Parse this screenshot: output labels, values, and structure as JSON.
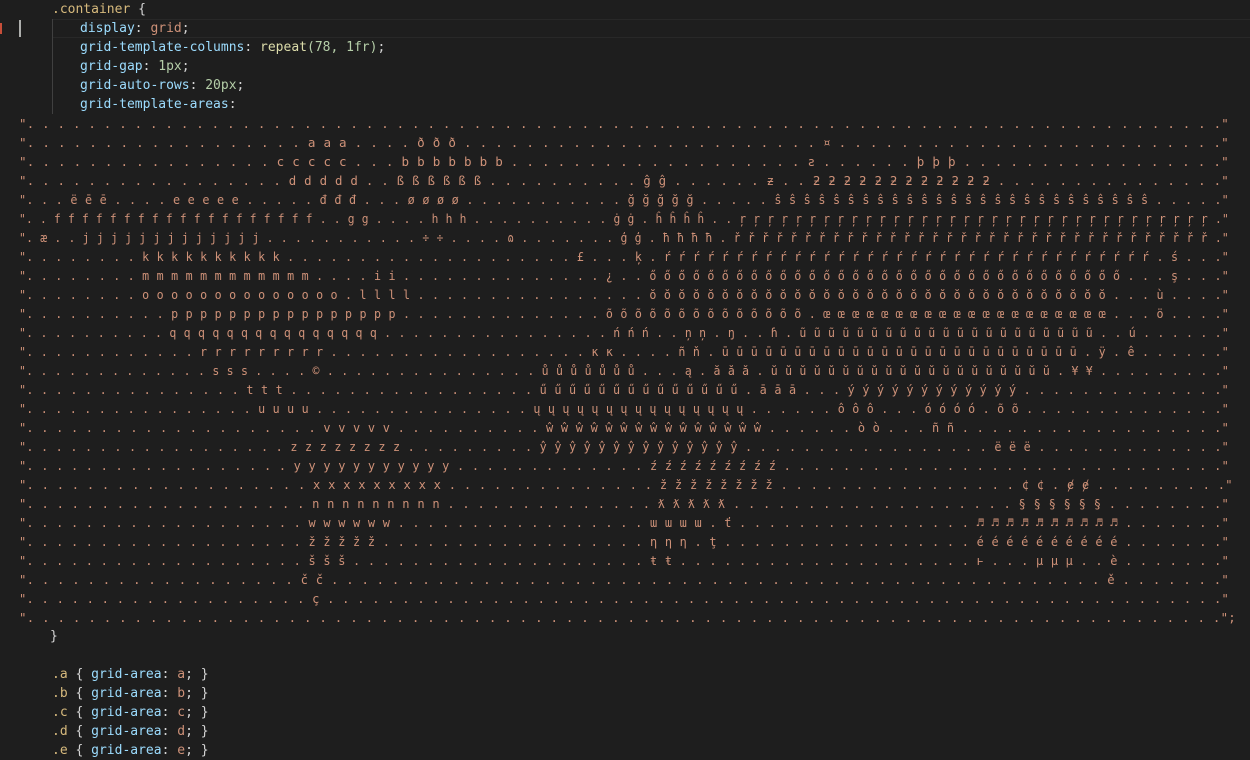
{
  "editor": {
    "code_lines": [
      {
        "kind": "selector_open",
        "selector": ".container",
        "brace": " {"
      },
      {
        "kind": "decl",
        "prop": "display",
        "value": "grid"
      },
      {
        "kind": "decl",
        "prop": "grid-template-columns",
        "fn": "repeat",
        "args": "(78, 1fr)"
      },
      {
        "kind": "decl",
        "prop": "grid-gap",
        "value": "1px"
      },
      {
        "kind": "decl",
        "prop": "grid-auto-rows",
        "value": "20px"
      },
      {
        "kind": "decl_open",
        "prop": "grid-template-areas"
      }
    ],
    "area_rows": [
      "\". . . . . . . . . . . . . . . . . . . . . . . . . . . . . . . . . . . . . . . . . . . . . . . . . . . . . . . . . . . . . . . . . . . . . . . . . . . . . .\"",
      "\". . . . . . . . . . . . . . . . . . a a a . . . . ð ð ð . . . . . . . . . . . . . . . . . . . . . . . ¤ . . . . . . . . . . . . . . . . . . . . . . . . .\"",
      "\". . . . . . . . . . . . . . . . c c c c c . . . b b b b b b b . . . . . . . . . . . . . . . . . . . ƨ . . . . . . þ þ þ . . . . . . . . . . . . . . . . .\"",
      "\". . . . . . . . . . . . . . . . . d d d d d . . ß ß ß ß ß ß . . . . . . . . . . ĝ ĝ . . . . . . ƶ . . ƻ ƻ ƻ ƻ ƻ ƻ ƻ ƻ ƻ ƻ ƻ ƻ . . . . . . . . . . . . . . .\"",
      "\". . . ë ē ē . . . . e e e e e . . . . . đ đ đ . . . ø ø ø ø . . . . . . . . . . . ğ ğ ğ ğ ğ . . . . . ŝ ŝ ŝ ŝ ŝ ŝ ŝ ŝ ŝ ŝ ŝ ŝ ŝ ŝ ŝ ŝ ŝ ŝ ŝ ŝ ŝ ŝ ŝ ŝ ŝ ŝ . . . . .\"",
      "\". . f f f f f f f f f f f f f f f f f f f . . g g . . . . h h h . . . . . . . . . . ġ ġ . ĥ ĥ ĥ ĥ . . ŗ ŗ ŗ ŗ ŗ ŗ ŗ ŗ ŗ ŗ ŗ ŗ ŗ ŗ ŗ ŗ ŗ ŗ ŗ ŗ ŗ ŗ ŗ ŗ ŗ ŗ ŗ ŗ ŗ ŗ ŗ ŗ ŗ ŗ .\"",
      "\". æ . . j j j j j j j j j j j j j . . . . . . . . . . . ÷ ÷ . . . . ɷ . . . . . . . ģ ģ . ħ ħ ħ ħ . ř ř ř ř ř ř ř ř ř ř ř ř ř ř ř ř ř ř ř ř ř ř ř ř ř ř ř ř ř ř ř ř ř ř .\"",
      "\". . . . . . . . k k k k k k k k k k . . . . . . . . . . . . . . . . . . . . £ . . . ķ . ŕ ŕ ŕ ŕ ŕ ŕ ŕ ŕ ŕ ŕ ŕ ŕ ŕ ŕ ŕ ŕ ŕ ŕ ŕ ŕ ŕ ŕ ŕ ŕ ŕ ŕ ŕ ŕ ŕ ŕ ŕ ŕ ŕ ŕ . ś . . .\"",
      "\". . . . . . . . m m m m m m m m m m m m . . . . i i . . . . . . . . . . . . . . ¿ . . ő ő ő ő ő ő ő ő ő ő ő ő ő ő ő ő ő ő ő ő ő ő ő ő ő ő ő ő ő ő ő ő ő . . . ş . . .\"",
      "\". . . . . . . . o o o o o o o o o o o o o o . l l l l . . . . . . . . . . . . . . . . ŏ ŏ ŏ ŏ ŏ ŏ ŏ ŏ ŏ ŏ ŏ ŏ ŏ ŏ ŏ ŏ ŏ ŏ ŏ ŏ ŏ ŏ ŏ ŏ ŏ ŏ ŏ ŏ ŏ ŏ ŏ ŏ . . . ù . . . .\"",
      "\". . . . . . . . . . p p p p p p p p p p p p p p p p . . . . . . . . . . . . . . õ õ õ õ õ õ õ õ õ õ õ õ õ õ . œ œ œ œ œ œ œ œ œ œ œ œ œ œ œ œ œ œ œ œ . . . ö . . . .\"",
      "\". . . . . . . . . . q q q q q q q q q q q q q q q . . . . . . . . . . . . . . . . ń ń ń . . ņ ņ . ŋ . . ɦ . ũ ũ ũ ũ ũ ũ ũ ũ ũ ũ ũ ũ ũ ũ ũ ũ ũ ũ ũ ũ ũ . . ú . . . . . .\"",
      "\". . . . . . . . . . . . r r r r r r r r r . . . . . . . . . . . . . . . . . . ĸ ĸ . . . . ñ ň . ū ū ū ū ū ū ū ū ū ū ū ū ū ū ū ū ū ū ū ū ū ū ū ū ū . ÿ . ê . . . . . .\"",
      "\". . . . . . . . . . . . . s s s . . . . © . . . . . . . . . . . . . . . ů ů ů ů ů ů ů . . . ą . ă ă ă . ŭ ŭ ŭ ŭ ŭ ŭ ŭ ŭ ŭ ŭ ŭ ŭ ŭ ŭ ŭ ŭ ŭ ŭ ŭ ŭ . ¥ ¥ . . . . . . . . .\"",
      "\". . . . . . . . . . . . . . . t t t . . . . . . . . . . . . . . . . . ű ű ű ű ű ű ű ű ű ű ű ű ű ű . ā ā ā . . . ý ý ý ý ý ý ý ý ý ý ý ý . . . . . . . . . . . . . .\"",
      "\". . . . . . . . . . . . . . . . u u u u . . . . . . . . . . . . . . . ų ų ų ų ų ų ų ų ų ų ų ų ų ų ų . . . . . . ô ô ô . . . ó ó ó ó . õ õ . . . . . . . . . . . . . .\"",
      "\". . . . . . . . . . . . . . . . . . . . v v v v v . . . . . . . . . . ŵ ŵ ŵ ŵ ŵ ŵ ŵ ŵ ŵ ŵ ŵ ŵ ŵ ŵ ŵ . . . . . . ò ò . . . ñ ñ . . . . . . . . . . . . . . . . . .\"",
      "\". . . . . . . . . . . . . . . . . . z z z z z z z z . . . . . . . . . ŷ ŷ ŷ ŷ ŷ ŷ ŷ ŷ ŷ ŷ ŷ ŷ ŷ ŷ . . . . . . . . . . . . . . . . . ë ë ë . . . . . . . . . . . . .\"",
      "\". . . . . . . . . . . . . . . . . . y y y y y y y y y y y . . . . . . . . . . . . . ź ź ź ź ź ź ź ź ź . . . . . . . . . . . . . . . . . . . . . . . . . . . . . .\"",
      "\". . . . . . . . . . . . . . . . . . . x x x x x x x x x . . . . . . . . . . . . . . ž ž ž ž ž ž ž ž . . . . . . . . . . . . . . . . ¢ ¢ . ɇ ɇ . . . . . . . . .\"",
      "\". . . . . . . . . . . . . . . . . . . n n n n n n n n n . . . . . . . . . . . . . . ƛ ƛ ƛ ƛ ƛ . . . . . . . . . . . . . . . . . . . § § § § § § . . . . . . . .\"",
      "\". . . . . . . . . . . . . . . . . . . w w w w w w . . . . . . . . . . . . . . . . . ɯ ɯ ɯ ɯ . ť . . . . . . . . . . . . . . . . ♬ ♬ ♬ ♬ ♬ ♬ ♬ ♬ ♬ ♬ . . . . . . .\"",
      "\". . . . . . . . . . . . . . . . . . . ž ž ž ž ž . . . . . . . . . . . . . . . . . . η η η . ţ . . . . . . . . . . . . . . . . . é é é é é é é é é é . . . . . . .\"",
      "\". . . . . . . . . . . . . . . . . . . š š š . . . . . . . . . . . . . . . . . . . . ŧ ŧ . . . . . . . . . . . . . . . . . . . . ⱶ . . . μ μ μ . . è . . . . . . .\"",
      "\". . . . . . . . . . . . . . . . . . č č . . . . . . . . . . . . . . . . . . . . . . . . . . . . . . . . . . . . . . . . . . . . . . . . . . . ě . . . . . . .\"",
      "\". . . . . . . . . . . . . . . . . . . ç . . . . . . . . . . . . . . . . . . . . . . . . . . . . . . . . . . . . . . . . . . . . . . . . . . . . . . . . . . . .\"",
      "\". . . . . . . . . . . . . . . . . . . . . . . . . . . . . . . . . . . . . . . . . . . . . . . . . . . . . . . . . . . . . . . . . . . . . . . . . . . . . .\";"
    ],
    "closing_brace": "}",
    "rules": [
      {
        "selector": ".a",
        "prop": "grid-area",
        "value": "a"
      },
      {
        "selector": ".b",
        "prop": "grid-area",
        "value": "b"
      },
      {
        "selector": ".c",
        "prop": "grid-area",
        "value": "c"
      },
      {
        "selector": ".d",
        "prop": "grid-area",
        "value": "d"
      },
      {
        "selector": ".e",
        "prop": "grid-area",
        "value": "e"
      }
    ]
  }
}
